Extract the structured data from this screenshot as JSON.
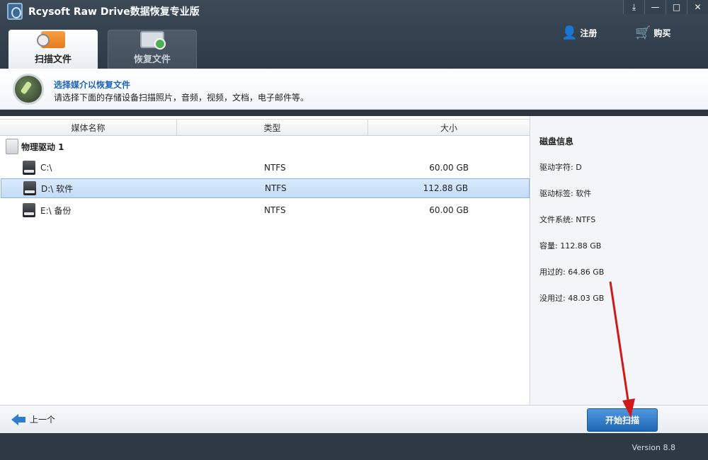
{
  "app": {
    "title": "Rcysoft Raw Drive数据恢复专业版"
  },
  "window_buttons": [
    "⤓",
    "—",
    "□",
    "✕"
  ],
  "tabs": [
    {
      "label": "扫描文件",
      "active": true,
      "icon": "scan-files-icon"
    },
    {
      "label": "恢复文件",
      "active": false,
      "icon": "recover-files-icon"
    }
  ],
  "header_actions": {
    "register": {
      "label": "注册",
      "icon": "user-add-icon"
    },
    "buy": {
      "label": "购买",
      "icon": "cart-icon"
    }
  },
  "banner": {
    "title": "选择媒介以恢复文件",
    "description": "请选择下面的存储设备扫描照片，音频，视频，文档，电子邮件等。"
  },
  "table": {
    "columns": [
      "媒体名称",
      "类型",
      "大小"
    ],
    "group": "物理驱动 1",
    "rows": [
      {
        "name": "C:\\",
        "type": "NTFS",
        "size": "60.00 GB",
        "selected": false
      },
      {
        "name": "D:\\ 软件",
        "type": "NTFS",
        "size": "112.88 GB",
        "selected": true
      },
      {
        "name": "E:\\ 备份",
        "type": "NTFS",
        "size": "60.00 GB",
        "selected": false
      }
    ]
  },
  "disk_info": {
    "title": "磁盘信息",
    "lines": [
      "驱动字符:  D",
      "驱动标签:  软件",
      "文件系统:  NTFS",
      "容量:  112.88 GB",
      "用过的:  64.86 GB",
      "没用过:  48.03 GB"
    ]
  },
  "footer": {
    "back_label": "上一个",
    "start_label": "开始扫描"
  },
  "status": {
    "version": "Version 8.8"
  },
  "colors": {
    "accent": "#1f67b4",
    "header_bg": "#2d3a47",
    "annotation_arrow": "#d01818"
  }
}
